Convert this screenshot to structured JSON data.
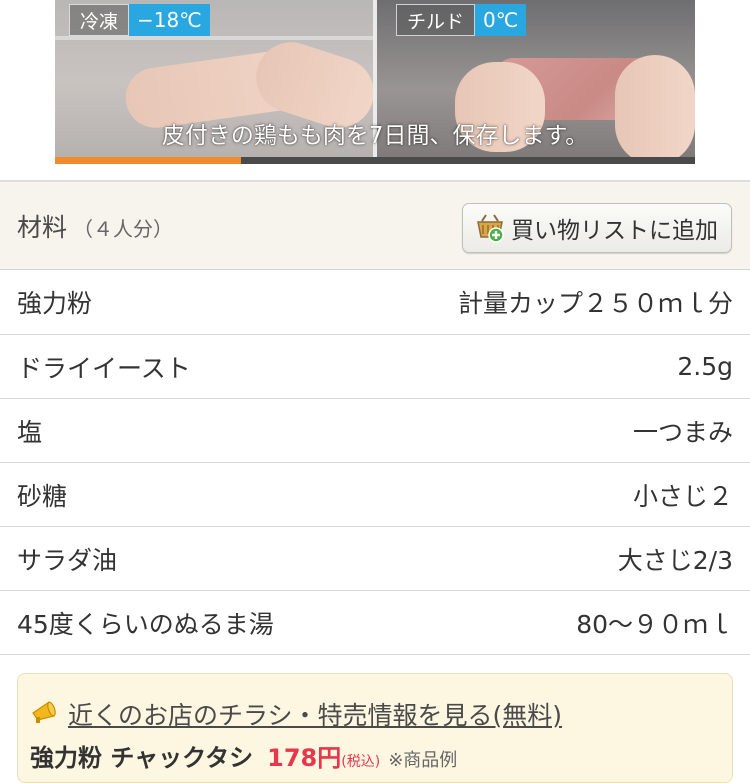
{
  "video": {
    "left_tag": {
      "label": "冷凍",
      "temp": "−18℃"
    },
    "right_tag": {
      "label": "チルド",
      "temp": "0℃"
    },
    "caption": "皮付きの鶏もも肉を7日間、保存します。",
    "progress": 0.29,
    "accent_color": "#f08a2b"
  },
  "ingredients": {
    "title": "材料",
    "servings": "（４人分）",
    "shopping_list_button": "買い物リストに追加",
    "items": [
      {
        "name": "強力粉",
        "amount": "計量カップ２５０ｍｌ分"
      },
      {
        "name": "ドライイースト",
        "amount": "2.5g"
      },
      {
        "name": "塩",
        "amount": "一つまみ"
      },
      {
        "name": "砂糖",
        "amount": "小さじ２"
      },
      {
        "name": "サラダ油",
        "amount": "大さじ2/3"
      },
      {
        "name": "45度くらいのぬるま湯",
        "amount": "80〜９０ｍｌ"
      }
    ]
  },
  "flyer": {
    "link_text": "近くのお店のチラシ・特売情報を見る(無料)",
    "icon": "megaphone-icon",
    "product": "強力粉 チャックタシ",
    "price": "178円",
    "tax": "(税込)",
    "note": "※商品例"
  }
}
